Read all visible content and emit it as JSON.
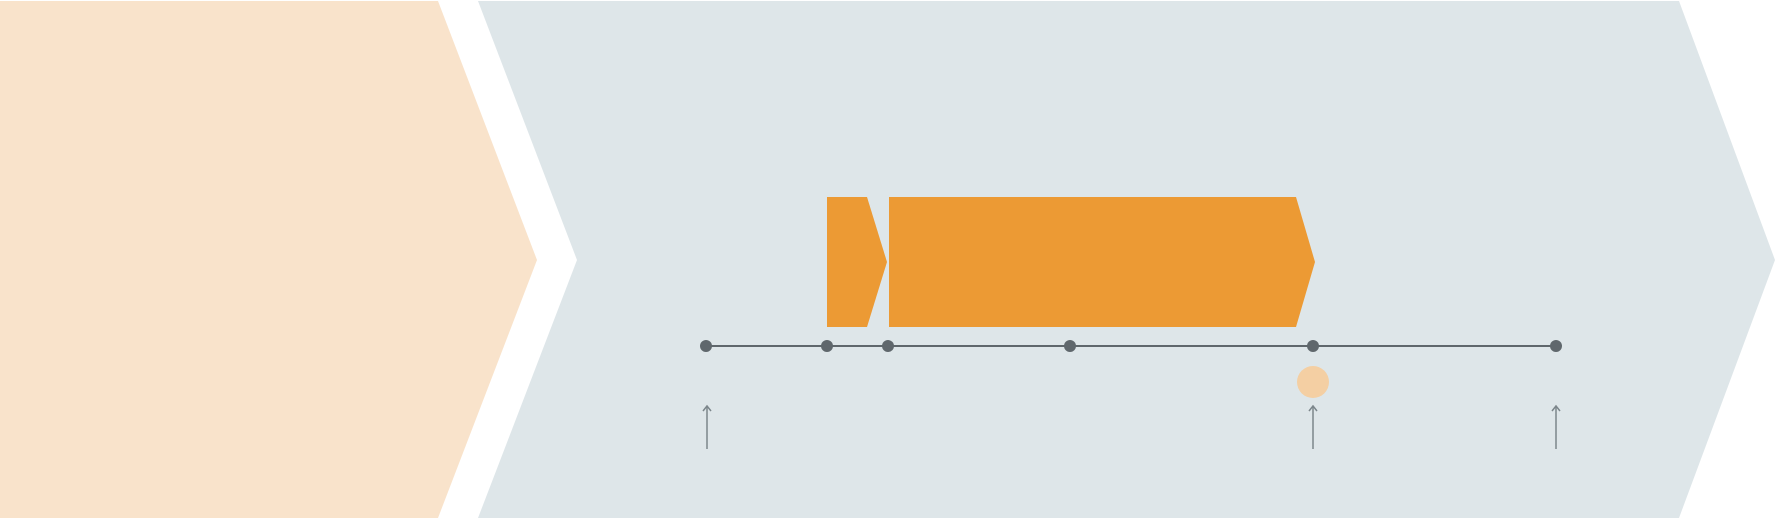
{
  "colors": {
    "background": "#ffffff",
    "left_chevron": "#f9e3cb",
    "right_chevron": "#dee6e9",
    "orange_block": "#ec9a34",
    "highlight_dot": "#f4cfa3",
    "timeline": "#5f676c",
    "arrow": "#7c868b"
  },
  "timeline": {
    "nodes": [
      {
        "name": "node-1"
      },
      {
        "name": "node-2"
      },
      {
        "name": "node-3"
      },
      {
        "name": "node-4"
      },
      {
        "name": "node-5"
      },
      {
        "name": "node-6"
      }
    ],
    "highlighted_node": 5,
    "arrow_nodes": [
      1,
      5,
      6
    ]
  }
}
